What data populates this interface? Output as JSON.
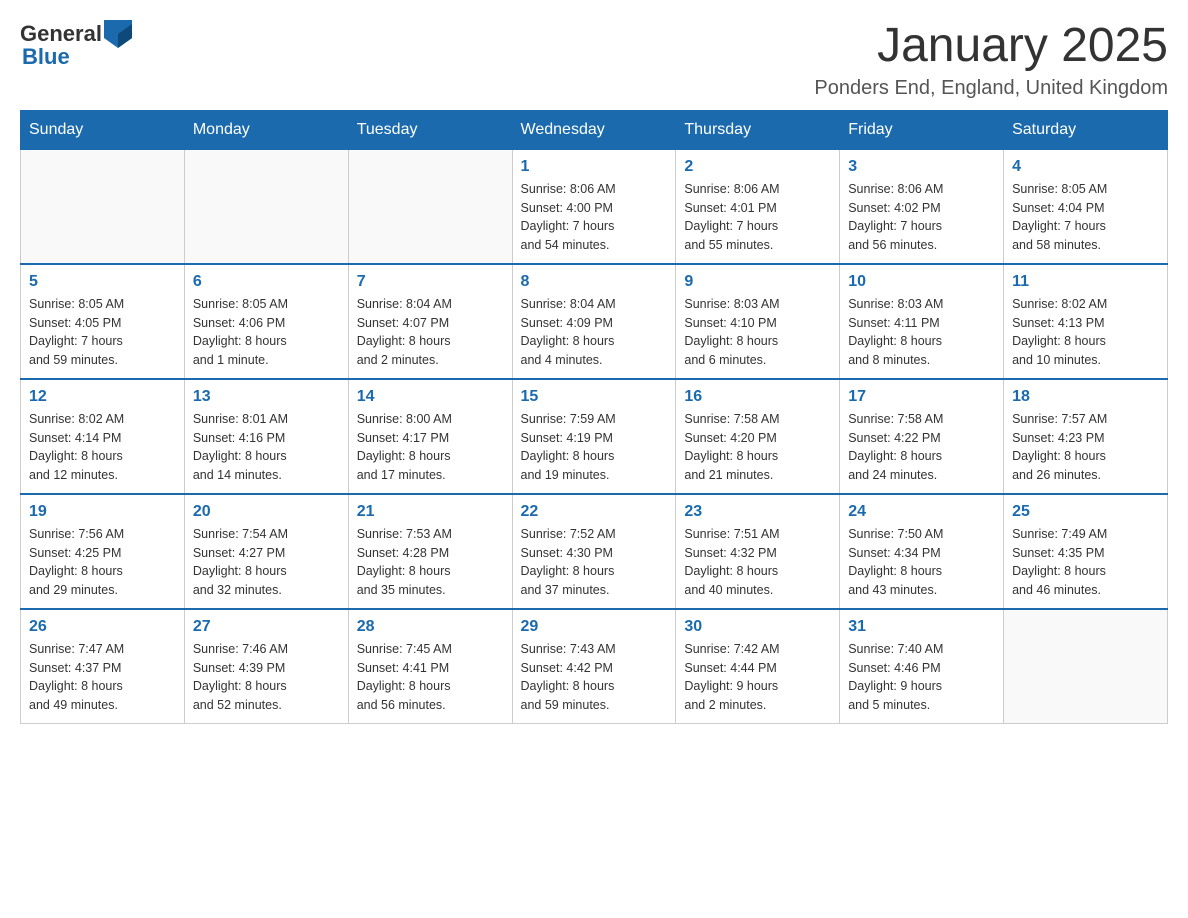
{
  "logo": {
    "text_general": "General",
    "text_blue": "Blue"
  },
  "title": "January 2025",
  "location": "Ponders End, England, United Kingdom",
  "weekdays": [
    "Sunday",
    "Monday",
    "Tuesday",
    "Wednesday",
    "Thursday",
    "Friday",
    "Saturday"
  ],
  "weeks": [
    [
      {
        "day": "",
        "info": ""
      },
      {
        "day": "",
        "info": ""
      },
      {
        "day": "",
        "info": ""
      },
      {
        "day": "1",
        "info": "Sunrise: 8:06 AM\nSunset: 4:00 PM\nDaylight: 7 hours\nand 54 minutes."
      },
      {
        "day": "2",
        "info": "Sunrise: 8:06 AM\nSunset: 4:01 PM\nDaylight: 7 hours\nand 55 minutes."
      },
      {
        "day": "3",
        "info": "Sunrise: 8:06 AM\nSunset: 4:02 PM\nDaylight: 7 hours\nand 56 minutes."
      },
      {
        "day": "4",
        "info": "Sunrise: 8:05 AM\nSunset: 4:04 PM\nDaylight: 7 hours\nand 58 minutes."
      }
    ],
    [
      {
        "day": "5",
        "info": "Sunrise: 8:05 AM\nSunset: 4:05 PM\nDaylight: 7 hours\nand 59 minutes."
      },
      {
        "day": "6",
        "info": "Sunrise: 8:05 AM\nSunset: 4:06 PM\nDaylight: 8 hours\nand 1 minute."
      },
      {
        "day": "7",
        "info": "Sunrise: 8:04 AM\nSunset: 4:07 PM\nDaylight: 8 hours\nand 2 minutes."
      },
      {
        "day": "8",
        "info": "Sunrise: 8:04 AM\nSunset: 4:09 PM\nDaylight: 8 hours\nand 4 minutes."
      },
      {
        "day": "9",
        "info": "Sunrise: 8:03 AM\nSunset: 4:10 PM\nDaylight: 8 hours\nand 6 minutes."
      },
      {
        "day": "10",
        "info": "Sunrise: 8:03 AM\nSunset: 4:11 PM\nDaylight: 8 hours\nand 8 minutes."
      },
      {
        "day": "11",
        "info": "Sunrise: 8:02 AM\nSunset: 4:13 PM\nDaylight: 8 hours\nand 10 minutes."
      }
    ],
    [
      {
        "day": "12",
        "info": "Sunrise: 8:02 AM\nSunset: 4:14 PM\nDaylight: 8 hours\nand 12 minutes."
      },
      {
        "day": "13",
        "info": "Sunrise: 8:01 AM\nSunset: 4:16 PM\nDaylight: 8 hours\nand 14 minutes."
      },
      {
        "day": "14",
        "info": "Sunrise: 8:00 AM\nSunset: 4:17 PM\nDaylight: 8 hours\nand 17 minutes."
      },
      {
        "day": "15",
        "info": "Sunrise: 7:59 AM\nSunset: 4:19 PM\nDaylight: 8 hours\nand 19 minutes."
      },
      {
        "day": "16",
        "info": "Sunrise: 7:58 AM\nSunset: 4:20 PM\nDaylight: 8 hours\nand 21 minutes."
      },
      {
        "day": "17",
        "info": "Sunrise: 7:58 AM\nSunset: 4:22 PM\nDaylight: 8 hours\nand 24 minutes."
      },
      {
        "day": "18",
        "info": "Sunrise: 7:57 AM\nSunset: 4:23 PM\nDaylight: 8 hours\nand 26 minutes."
      }
    ],
    [
      {
        "day": "19",
        "info": "Sunrise: 7:56 AM\nSunset: 4:25 PM\nDaylight: 8 hours\nand 29 minutes."
      },
      {
        "day": "20",
        "info": "Sunrise: 7:54 AM\nSunset: 4:27 PM\nDaylight: 8 hours\nand 32 minutes."
      },
      {
        "day": "21",
        "info": "Sunrise: 7:53 AM\nSunset: 4:28 PM\nDaylight: 8 hours\nand 35 minutes."
      },
      {
        "day": "22",
        "info": "Sunrise: 7:52 AM\nSunset: 4:30 PM\nDaylight: 8 hours\nand 37 minutes."
      },
      {
        "day": "23",
        "info": "Sunrise: 7:51 AM\nSunset: 4:32 PM\nDaylight: 8 hours\nand 40 minutes."
      },
      {
        "day": "24",
        "info": "Sunrise: 7:50 AM\nSunset: 4:34 PM\nDaylight: 8 hours\nand 43 minutes."
      },
      {
        "day": "25",
        "info": "Sunrise: 7:49 AM\nSunset: 4:35 PM\nDaylight: 8 hours\nand 46 minutes."
      }
    ],
    [
      {
        "day": "26",
        "info": "Sunrise: 7:47 AM\nSunset: 4:37 PM\nDaylight: 8 hours\nand 49 minutes."
      },
      {
        "day": "27",
        "info": "Sunrise: 7:46 AM\nSunset: 4:39 PM\nDaylight: 8 hours\nand 52 minutes."
      },
      {
        "day": "28",
        "info": "Sunrise: 7:45 AM\nSunset: 4:41 PM\nDaylight: 8 hours\nand 56 minutes."
      },
      {
        "day": "29",
        "info": "Sunrise: 7:43 AM\nSunset: 4:42 PM\nDaylight: 8 hours\nand 59 minutes."
      },
      {
        "day": "30",
        "info": "Sunrise: 7:42 AM\nSunset: 4:44 PM\nDaylight: 9 hours\nand 2 minutes."
      },
      {
        "day": "31",
        "info": "Sunrise: 7:40 AM\nSunset: 4:46 PM\nDaylight: 9 hours\nand 5 minutes."
      },
      {
        "day": "",
        "info": ""
      }
    ]
  ]
}
